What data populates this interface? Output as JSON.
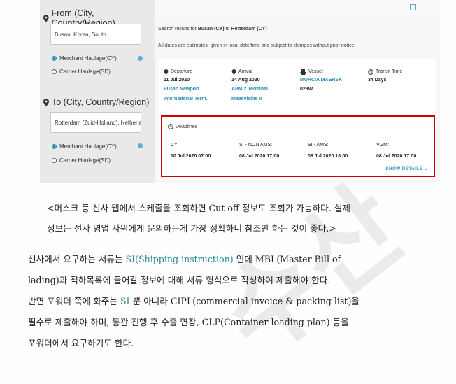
{
  "watermark": "수산",
  "screenshot": {
    "from_label": "From (City, Country/Region)",
    "from_value": "Busan, Korea, South",
    "from_opt1": "Merchant Haulage(CY)",
    "from_opt2": "Carrier Haulage(SD)",
    "to_label": "To (City, Country/Region)",
    "to_value": "Rotterdam (Zuid-Holland), Netherlands",
    "to_opt1": "Merchant Haulage(CY)",
    "to_opt2": "Carrier Haulage(SD)",
    "search_prefix": "Search results for",
    "search_from": "Busan (CY)",
    "search_to_word": "to",
    "search_to": "Rotterdam (CY)",
    "note": "All dates are estimates, given in local date/time and subject to changes without prior notice.",
    "departure_h": "Departure",
    "departure_date": "11 Jul 2020",
    "departure_p1": "Pusan Newport",
    "departure_p2": "International Term.",
    "arrival_h": "Arrival",
    "arrival_date": "14 Aug 2020",
    "arrival_p1": "APM 2 Terminal",
    "arrival_p2": "Maasvlakte II",
    "vessel_h": "Vessel",
    "vessel_name": "MURCIA MAERSK",
    "vessel_voy": "028W",
    "transit_h": "Transit Time",
    "transit_v": "34 Days",
    "deadlines_h": "Deadlines",
    "d1_l": "CY:",
    "d1_v": "10 Jul 2020 07:00",
    "d2_l": "SI - NON AMS:",
    "d2_v": "08 Jul 2020 17:00",
    "d3_l": "SI - AMS:",
    "d3_v": "08 Jul 2020 18:00",
    "d4_l": "VGM:",
    "d4_v": "08 Jul 2020 17:00",
    "show_details": "SHOW DETAILS ⌄"
  },
  "caption_l1": "<머스크 등 선사 웹에서 스케줄을 조회하면 Cut off 정보도 조회가 가능하다. 실제",
  "caption_l2": "정보는 선사 영업 사원에게 문의하는게 가장 정확하니 참조만 하는 것이 좋다.>",
  "p1_a": "선사에서 요구하는 서류는 ",
  "p1_si": "SI(Shipping instruction)",
  "p1_b": " 인데 MBL(Master Bill of",
  "p2": "lading)과 적하목록에 들어갈 정보에 대해 서류 형식으로 작성하여 제출해야 한다.",
  "p3_a": "반면 포워더 쪽에 화주는 ",
  "p3_si": "SI",
  "p3_b": " 뿐 아니라 CIPL(commercial invoice & packing list)을",
  "p4": "필수로 제출해야 하며, 통관 진행 후 수출 면장, CLP(Container loading plan) 등을",
  "p5": "포워더에서 요구하기도 한다.",
  "colors": {
    "accent_link": "#2b8bb5",
    "highlight_box": "#d40000",
    "teal_text": "#2a8a8a"
  }
}
